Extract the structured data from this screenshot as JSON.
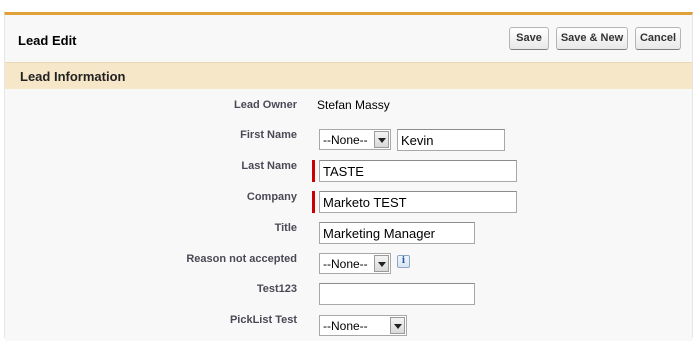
{
  "header": {
    "title": "Lead Edit",
    "buttons": {
      "save": "Save",
      "save_new": "Save & New",
      "cancel": "Cancel"
    }
  },
  "section": {
    "title": "Lead Information"
  },
  "fields": {
    "lead_owner": {
      "label": "Lead Owner",
      "value": "Stefan Massy"
    },
    "first_name": {
      "label": "First Name",
      "salutation": "--None--",
      "value": "Kevin"
    },
    "last_name": {
      "label": "Last Name",
      "value": "TASTE",
      "required": true
    },
    "company": {
      "label": "Company",
      "value": "Marketo TEST",
      "required": true
    },
    "title": {
      "label": "Title",
      "value": "Marketing Manager"
    },
    "reason_not_accepted": {
      "label": "Reason not accepted",
      "value": "--None--",
      "info_icon": "info-icon"
    },
    "test123": {
      "label": "Test123",
      "value": ""
    },
    "picklist_test": {
      "label": "PickList Test",
      "value": "--None--"
    }
  },
  "colors": {
    "accent_border": "#e1a13a",
    "section_bg": "#f7e7c9",
    "required": "#cc0000"
  }
}
